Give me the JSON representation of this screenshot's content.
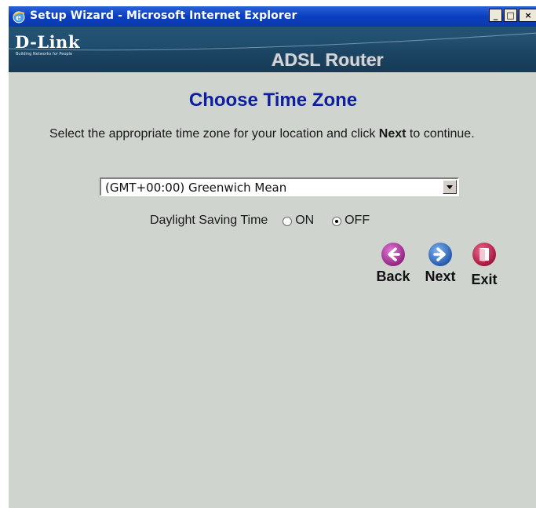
{
  "window": {
    "title": "Setup Wizard - Microsoft Internet Explorer",
    "controls": {
      "minimize": "_",
      "maximize": "□",
      "close": "×"
    }
  },
  "banner": {
    "brand": "D-Link",
    "tagline": "Building Networks for People",
    "product": "ADSL Router"
  },
  "page": {
    "title": "Choose Time Zone",
    "instruction_before": "Select the appropriate time zone for your location and click ",
    "instruction_bold": "Next",
    "instruction_after": " to continue."
  },
  "timezone": {
    "selected": "(GMT+00:00) Greenwich Mean"
  },
  "dst": {
    "label": "Daylight Saving Time",
    "on_label": "ON",
    "off_label": "OFF",
    "selected": "OFF"
  },
  "nav": {
    "back_label": "Back",
    "next_label": "Next",
    "exit_label": "Exit"
  },
  "colors": {
    "title_blue": "#0c1f9e",
    "back_purple": "#a0268f",
    "next_blue": "#2f6fc9",
    "exit_red": "#c4154a"
  }
}
